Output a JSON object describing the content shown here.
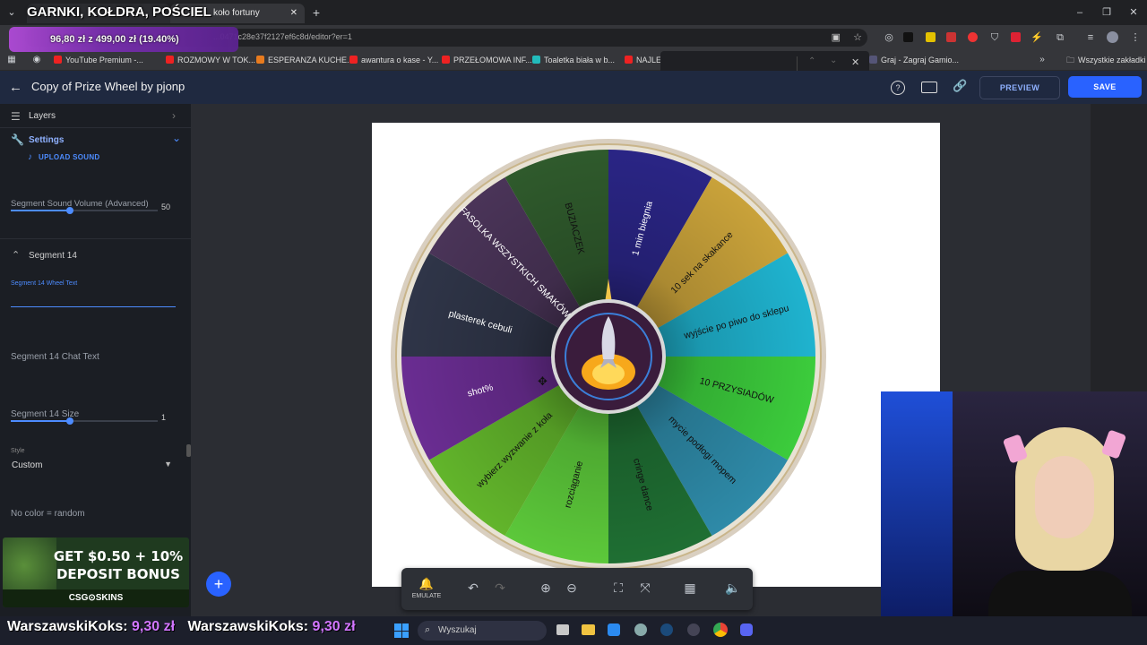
{
  "overlay": {
    "stream_title": "GARNKI, KOŁDRA, POŚCIEL",
    "goal_text": "96,80 zł z 499,00 zł (19.40%)",
    "donation_ticker": [
      {
        "name": "WarszawskiKoks:",
        "amount": "9,30 zł"
      },
      {
        "name": "WarszawskiKoks:",
        "amount": "9,30 zł"
      }
    ],
    "ad": {
      "line1": "GET $0.50 + 10%",
      "line2": "DEPOSIT BONUS",
      "brand": "CSG⊙SKINS"
    }
  },
  "browser": {
    "active_tab": "koło fortuny",
    "url": "...0471c28e37f2127ef6c8d/editor?er=1",
    "bookmarks": [
      "YouTube Premium -...",
      "ROZMOWY W TOK...",
      "ESPERANZA KUCHE...",
      "awantura o kase - Y...",
      "PRZEŁOMOWA INF...",
      "Toaletka biała w b...",
      "NAJLE",
      "Graj - Zagraj Gamio..."
    ],
    "bookmarks_folder": "Wszystkie zakładki"
  },
  "app": {
    "title": "Copy of Prize Wheel by pjonp",
    "preview_label": "PREVIEW",
    "save_label": "SAVE"
  },
  "sidebar": {
    "layers": "Layers",
    "settings": "Settings",
    "upload_sound": "UPLOAD SOUND",
    "sound_volume_label": "Segment Sound Volume (Advanced)",
    "sound_volume_value": "50",
    "sound_volume_level": 0.4,
    "segment_header": "Segment 14",
    "wheel_text_label": "Segment 14 Wheel Text",
    "chat_text_label": "Segment 14 Chat Text",
    "size_label": "Segment 14 Size",
    "size_value": "1",
    "style_label": "Style",
    "style_value": "Custom",
    "no_color": "No color = random"
  },
  "wheel": {
    "segments": [
      {
        "text": "1 min biegnia",
        "color": "#2a2585"
      },
      {
        "text": "10 sek na skakance",
        "color": "#c9a23a"
      },
      {
        "text": "wyjście po piwo do sklepu",
        "color": "#1fb3cf"
      },
      {
        "text": "10 PRZYSIADÓW",
        "color": "#3ccc3c"
      },
      {
        "text": "mycie podłogi mopem",
        "color": "#2e8aa8"
      },
      {
        "text": "cringe dance",
        "color": "#1f6f33"
      },
      {
        "text": "rozciąganie",
        "color": "#5cc83a"
      },
      {
        "text": "wybierz wyzwanie z koła",
        "color": "#62b52b"
      },
      {
        "text": "shot%",
        "color": "#6a2d92"
      },
      {
        "text": "plasterek cebuli",
        "color": "#2f3548"
      },
      {
        "text": "FASOLKA WSZYSTKICH SMAKÓW",
        "color": "#4a3458"
      },
      {
        "text": "BUZIACZEK",
        "color": "#2f5a2c"
      }
    ]
  },
  "toolbar": {
    "emulate": "EMULATE"
  },
  "taskbar": {
    "search_placeholder": "Wyszukaj"
  },
  "colors": {
    "accent": "#2962ff",
    "appbar": "#1f2940",
    "link": "#4d8cff"
  }
}
